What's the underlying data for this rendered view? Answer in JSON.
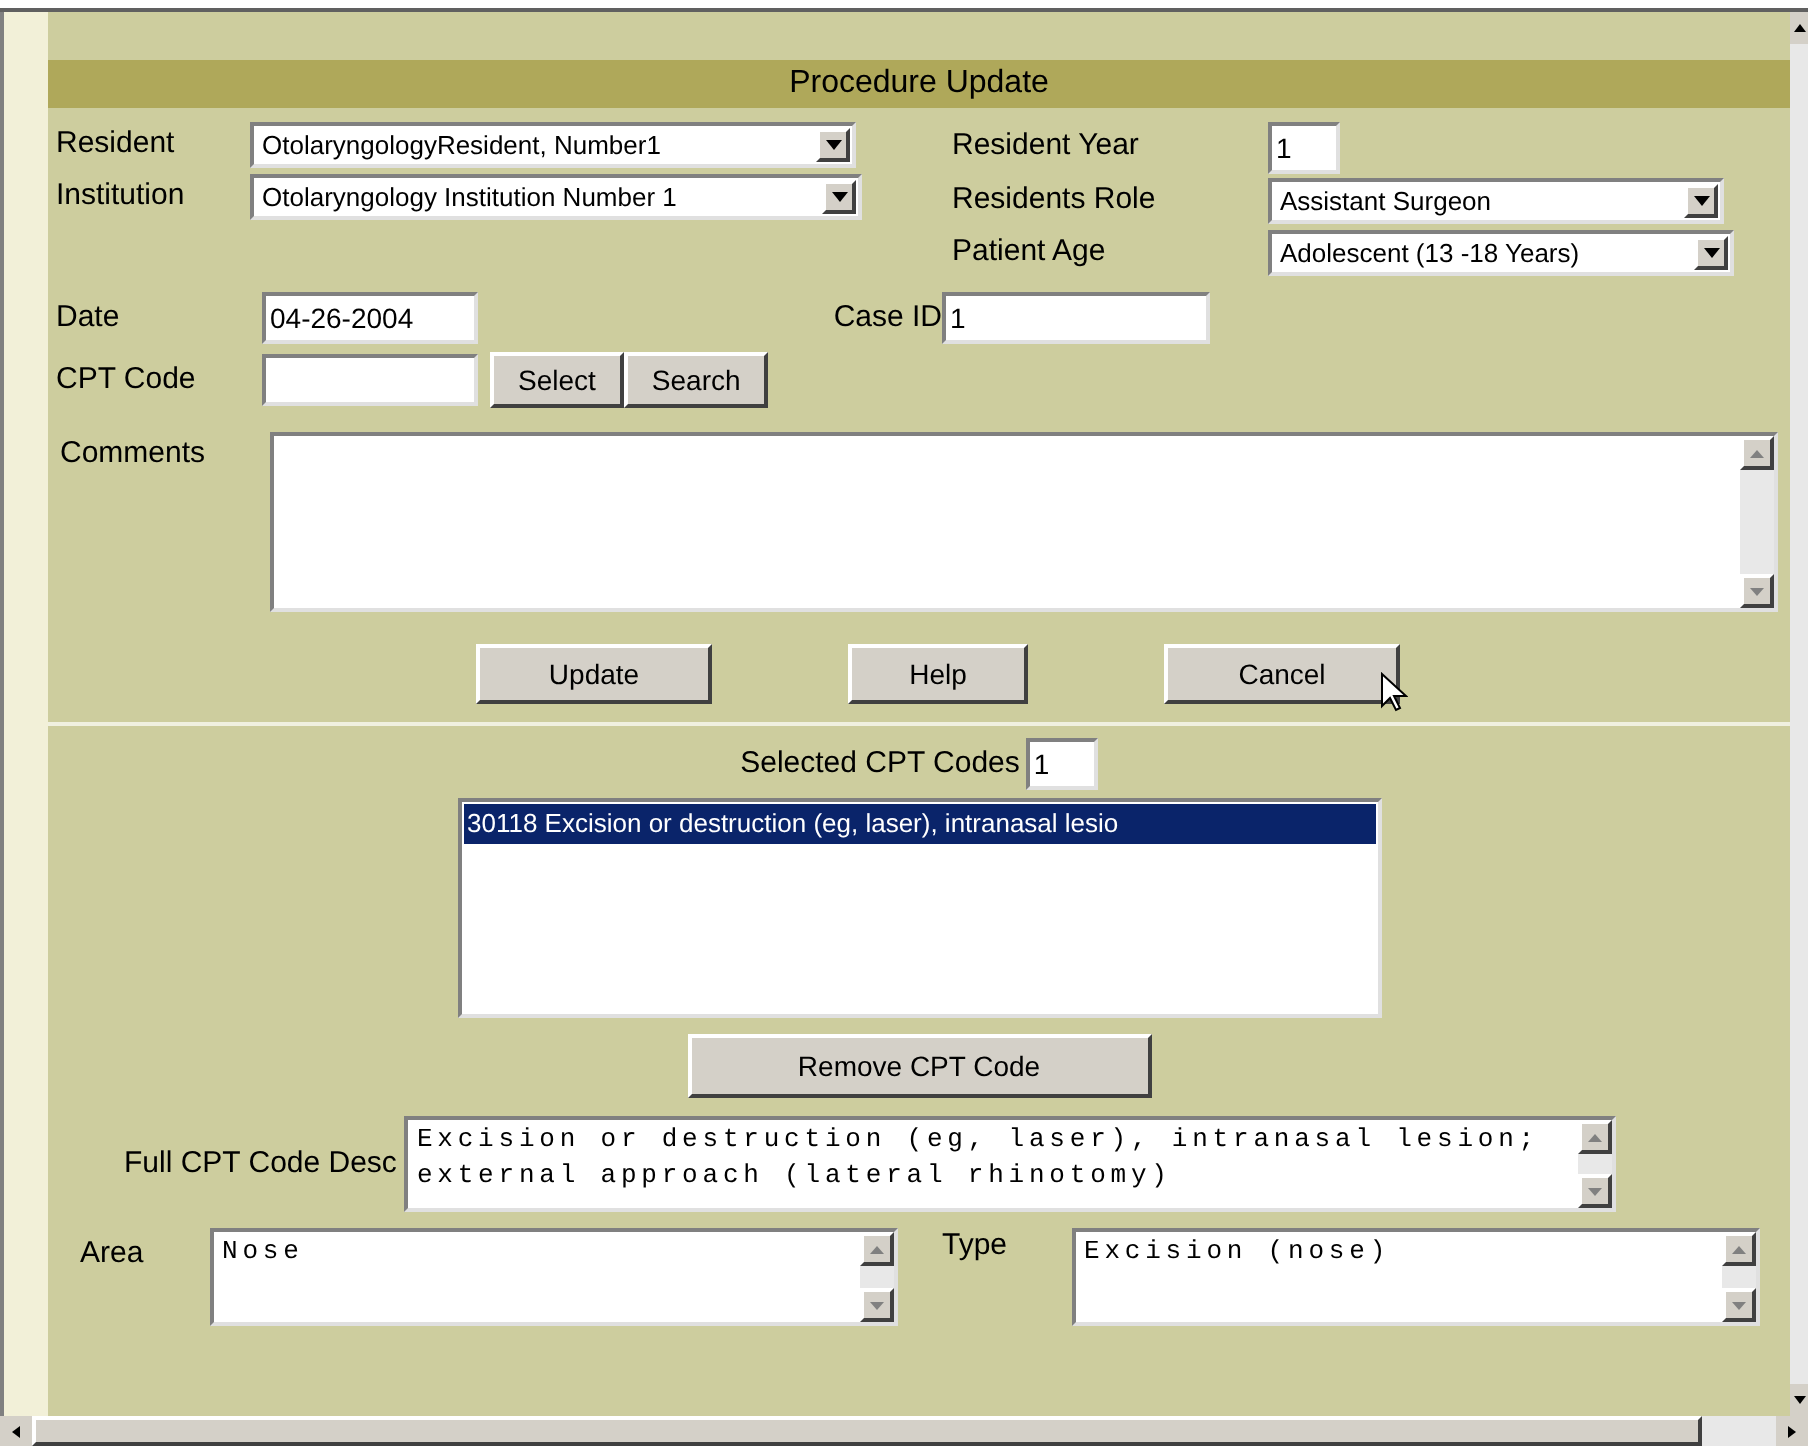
{
  "title": "Procedure Update",
  "resident": {
    "label": "Resident",
    "value": "OtolaryngologyResident, Number1"
  },
  "institution": {
    "label": "Institution",
    "value": "Otolaryngology Institution Number 1"
  },
  "resident_year": {
    "label": "Resident Year",
    "value": "1"
  },
  "residents_role": {
    "label": "Residents Role",
    "value": "Assistant Surgeon"
  },
  "patient_age": {
    "label": "Patient Age",
    "value": "Adolescent (13 -18 Years)"
  },
  "date": {
    "label": "Date",
    "value": "04-26-2004"
  },
  "case_id": {
    "label": "Case ID",
    "value": "1"
  },
  "cpt_code": {
    "label": "CPT Code",
    "buttons": [
      "Select",
      "Search"
    ]
  },
  "comments": {
    "label": "Comments"
  },
  "actions": [
    "Update",
    "Help",
    "Cancel"
  ],
  "selected_codes": {
    "label": "Selected CPT Codes",
    "count": "1",
    "items": [
      {
        "text": "30118 Excision or destruction (eg, laser), intranasal lesio",
        "selected": true
      }
    ],
    "remove_button": "Remove CPT Code"
  },
  "full_desc": {
    "label": "Full CPT Code Desc",
    "value": "Excision or destruction (eg, laser), intranasal lesion; external approach (lateral rhinotomy)"
  },
  "area": {
    "label": "Area",
    "value": "Nose"
  },
  "type": {
    "label": "Type",
    "value": "Excision (nose)"
  }
}
